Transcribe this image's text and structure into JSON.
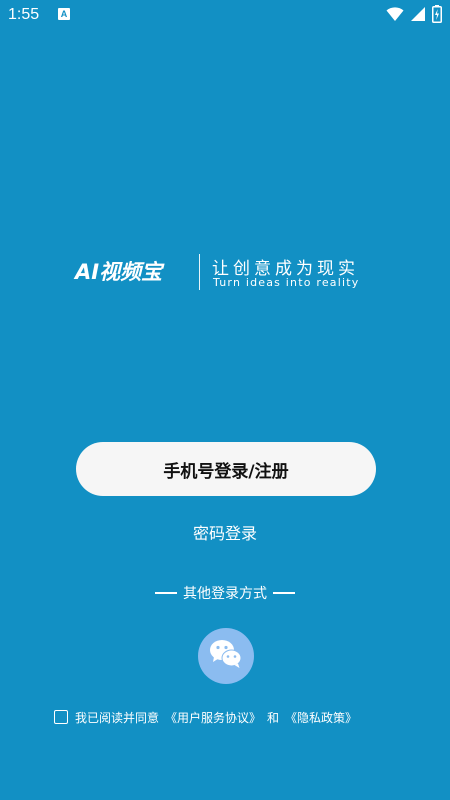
{
  "status_bar": {
    "time": "1:55",
    "notification_icon_letter": "A",
    "icons": [
      "wifi-icon",
      "cellular-signal-icon",
      "battery-charging-icon"
    ]
  },
  "brand": {
    "name": "AI视频宝",
    "slogan": "让创意成为现实",
    "slogan_en": "Turn ideas into reality"
  },
  "login": {
    "phone_button_label": "手机号登录/注册",
    "password_link_label": "密码登录",
    "other_methods_label": "其他登录方式",
    "wechat_icon": "wechat-icon"
  },
  "agreement": {
    "prefix": "我已阅读并同意",
    "user_agreement": "《用户服务协议》",
    "conjunction": "和",
    "privacy_policy": "《隐私政策》",
    "checked": false
  },
  "colors": {
    "background": "#1290c4",
    "primary_button_bg": "#f6f6f6",
    "wechat_circle": "#8bbcf0",
    "text": "#ffffff"
  }
}
